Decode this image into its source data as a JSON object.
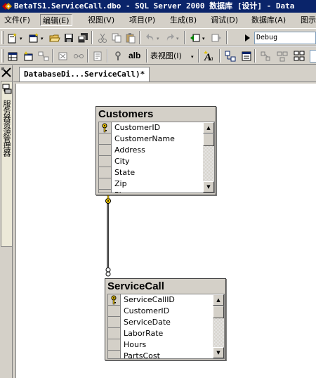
{
  "window": {
    "title": "BetaTS1.ServiceCall.dbo - SQL Server 2000 数据库 [设计] - Data"
  },
  "menubar": {
    "items": [
      {
        "label": "文件(F)",
        "active": false
      },
      {
        "label": "编辑(E)",
        "active": true
      },
      {
        "label": "视图(V)",
        "active": false
      },
      {
        "label": "项目(P)",
        "active": false
      },
      {
        "label": "生成(B)",
        "active": false
      },
      {
        "label": "调试(D)",
        "active": false
      },
      {
        "label": "数据库(A)",
        "active": false
      },
      {
        "label": "图示",
        "active": false
      }
    ]
  },
  "toolbar1": {
    "config_combo_value": "Debug"
  },
  "toolbar2": {
    "table_view_label": "表视图(I)",
    "alb_label": "alb"
  },
  "left_panel": {
    "tab_label": "服务器资源管理器"
  },
  "document": {
    "tab_label": "DatabaseDi...ServiceCall)*"
  },
  "diagram": {
    "tables": [
      {
        "title": "Customers",
        "columns": [
          {
            "name": "CustomerID",
            "key": true
          },
          {
            "name": "CustomerName",
            "key": false
          },
          {
            "name": "Address",
            "key": false
          },
          {
            "name": "City",
            "key": false
          },
          {
            "name": "State",
            "key": false
          },
          {
            "name": "Zip",
            "key": false
          },
          {
            "name": "Phone",
            "key": false
          }
        ]
      },
      {
        "title": "ServiceCall",
        "columns": [
          {
            "name": "ServiceCallID",
            "key": true
          },
          {
            "name": "CustomerID",
            "key": false
          },
          {
            "name": "ServiceDate",
            "key": false
          },
          {
            "name": "LaborRate",
            "key": false
          },
          {
            "name": "Hours",
            "key": false
          },
          {
            "name": "PartsCost",
            "key": false
          }
        ]
      }
    ]
  },
  "colors": {
    "titlebar": "#0a246a",
    "face": "#d4d0c8",
    "canvas": "#ffffff",
    "key_icon": "#f0c800"
  }
}
